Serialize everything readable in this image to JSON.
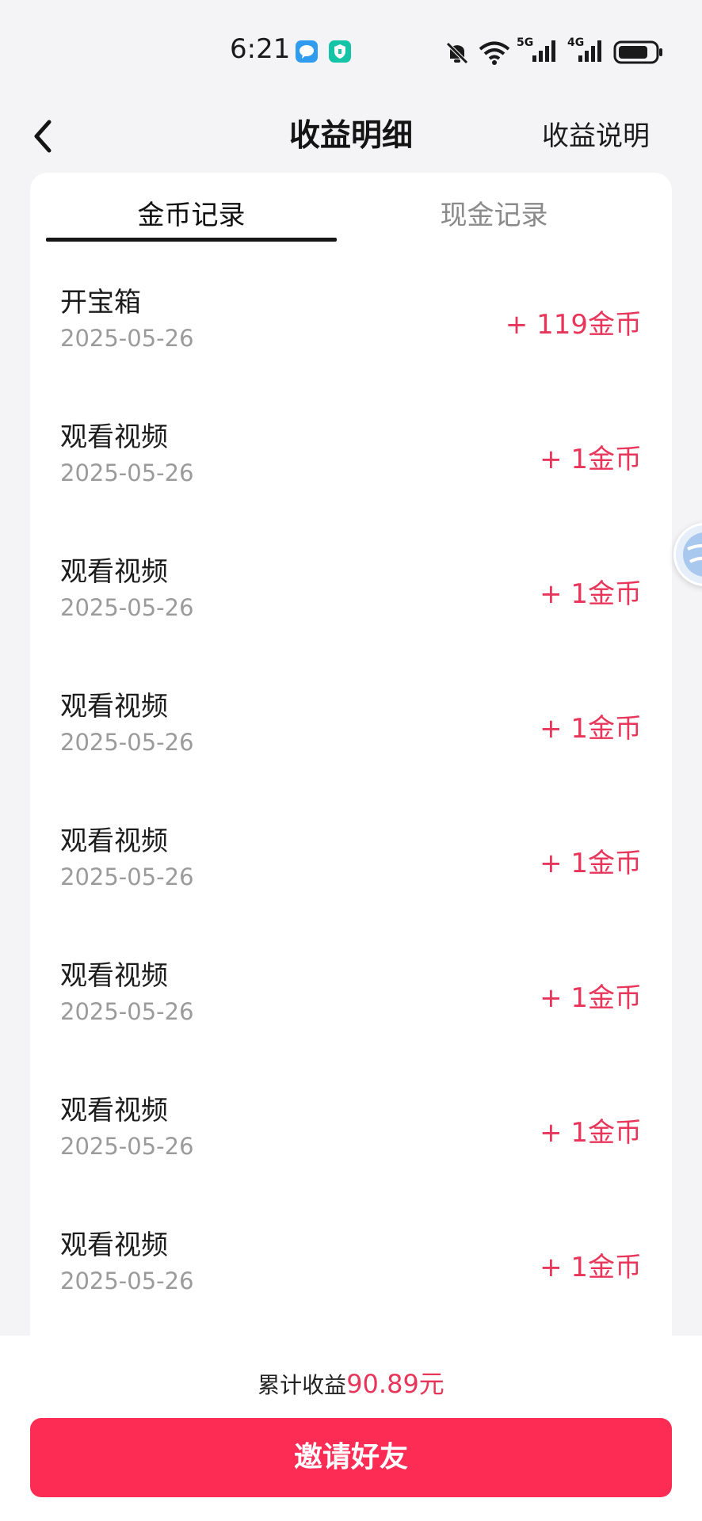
{
  "status_bar": {
    "time": "6:21",
    "network_labels": [
      "5G",
      "4G"
    ],
    "icons": [
      "message-icon",
      "shield-icon",
      "mute-bell-icon",
      "wifi-icon",
      "signal-5g-icon",
      "signal-4g-icon",
      "battery-icon"
    ]
  },
  "header": {
    "title": "收益明细",
    "help_link": "收益说明",
    "back_icon": "chevron-left-icon"
  },
  "tabs": [
    {
      "label": "金币记录",
      "active": true
    },
    {
      "label": "现金记录",
      "active": false
    }
  ],
  "records": [
    {
      "title": "开宝箱",
      "date": "2025-05-26",
      "amount": "+ 119金币"
    },
    {
      "title": "观看视频",
      "date": "2025-05-26",
      "amount": "+ 1金币"
    },
    {
      "title": "观看视频",
      "date": "2025-05-26",
      "amount": "+ 1金币"
    },
    {
      "title": "观看视频",
      "date": "2025-05-26",
      "amount": "+ 1金币"
    },
    {
      "title": "观看视频",
      "date": "2025-05-26",
      "amount": "+ 1金币"
    },
    {
      "title": "观看视频",
      "date": "2025-05-26",
      "amount": "+ 1金币"
    },
    {
      "title": "观看视频",
      "date": "2025-05-26",
      "amount": "+ 1金币"
    },
    {
      "title": "观看视频",
      "date": "2025-05-26",
      "amount": "+ 1金币"
    }
  ],
  "footer": {
    "total_label": "累计收益",
    "total_amount": "90.89元",
    "invite_button": "邀请好友"
  },
  "colors": {
    "accent": "#fd2c55",
    "amount_text": "#e8365a",
    "background": "#f4f4f6"
  }
}
